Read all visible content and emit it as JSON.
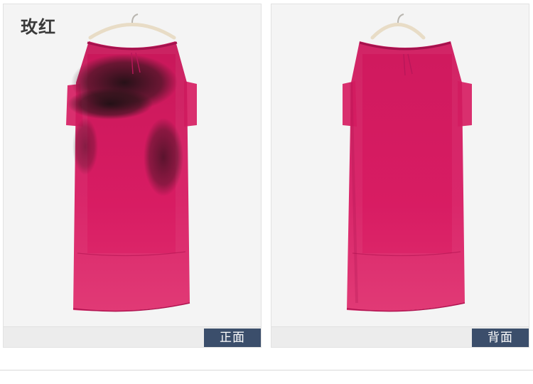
{
  "color_name": "玫红",
  "views": [
    {
      "label": "正面",
      "garment_color": "#d81c63",
      "print_color": "#2a1418"
    },
    {
      "label": "背面",
      "garment_color": "#d81c63"
    }
  ]
}
